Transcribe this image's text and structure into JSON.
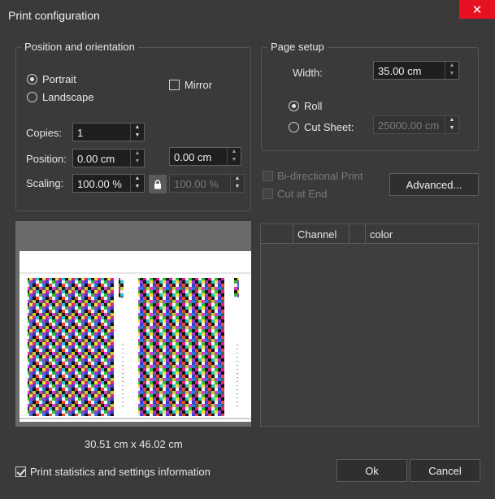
{
  "window": {
    "title": "Print configuration",
    "close_glyph": "✕"
  },
  "position_group": {
    "label": "Position and orientation",
    "portrait": "Portrait",
    "landscape": "Landscape",
    "mirror": "Mirror",
    "copies_label": "Copies:",
    "copies_value": "1",
    "position_label": "Position:",
    "position_x": "0.00 cm",
    "position_y": "0.00 cm",
    "scaling_label": "Scaling:",
    "scaling_x": "100.00 %",
    "scaling_y": "100.00 %"
  },
  "page_setup": {
    "label": "Page setup",
    "width_label": "Width:",
    "width_value": "35.00 cm",
    "roll": "Roll",
    "cut_sheet": "Cut Sheet:",
    "cut_sheet_value": "25000.00 cm"
  },
  "options": {
    "bidirectional": "Bi-directional Print",
    "cut_at_end": "Cut at End",
    "advanced_button": "Advanced..."
  },
  "preview": {
    "size_text": "30.51 cm x 46.02 cm"
  },
  "channel_table": {
    "columns": [
      "",
      "Channel",
      "",
      "color"
    ]
  },
  "footer": {
    "print_stats": "Print statistics and settings information",
    "ok": "Ok",
    "cancel": "Cancel"
  },
  "arrows": {
    "up": "▲",
    "down": "▼"
  },
  "colors": {
    "accent_close": "#e81123",
    "background": "#3a3a3a"
  }
}
